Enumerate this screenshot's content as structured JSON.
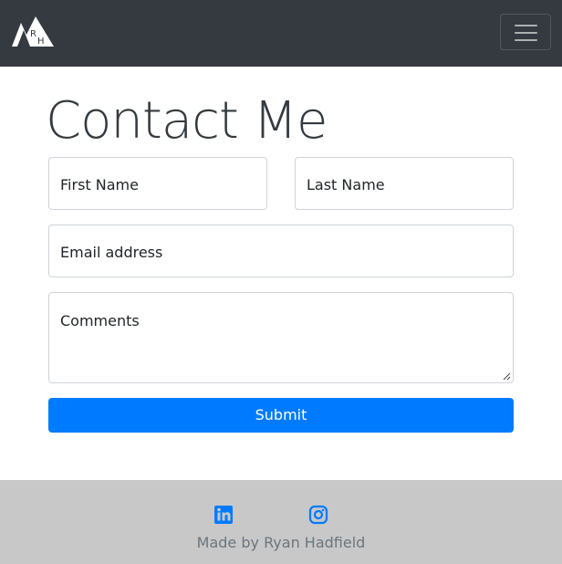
{
  "header": {
    "logo_letters": [
      "R",
      "H"
    ],
    "menu_icon": "hamburger-icon"
  },
  "page": {
    "title": "Contact Me"
  },
  "form": {
    "first_name_placeholder": "First Name",
    "last_name_placeholder": "Last Name",
    "email_placeholder": "Email address",
    "comments_placeholder": "Comments",
    "submit_label": "Submit"
  },
  "footer": {
    "social": [
      {
        "icon": "linkedin-icon"
      },
      {
        "icon": "instagram-icon"
      }
    ],
    "credit": "Made by Ryan Hadfield"
  },
  "colors": {
    "navbar": "#343a40",
    "primary": "#007bff",
    "footer": "#c8c8c8",
    "muted_text": "#6c757d"
  }
}
